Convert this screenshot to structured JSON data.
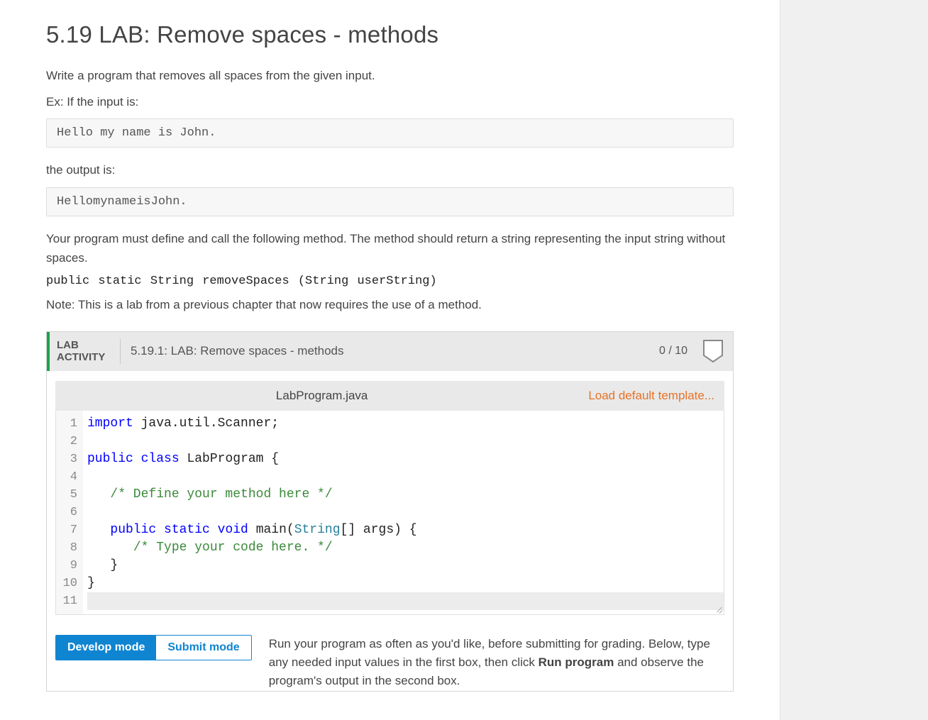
{
  "title": "5.19 LAB: Remove spaces - methods",
  "instructions": {
    "intro": "Write a program that removes all spaces from the given input.",
    "ex_label": "Ex: If the input is:",
    "example_input": "Hello my name is John.",
    "out_label": "the output is:",
    "example_output": "HellomynameisJohn.",
    "define_call": "Your program must define and call the following method. The method should return a string representing the input string without spaces.",
    "method_signature": "public static String removeSpaces (String userString)",
    "note": "Note: This is a lab from a previous chapter that now requires the use of a method."
  },
  "activity": {
    "badge_line1": "LAB",
    "badge_line2": "ACTIVITY",
    "title": "5.19.1: LAB: Remove spaces - methods",
    "score": "0 / 10",
    "file_name": "LabProgram.java",
    "load_template_label": "Load default template...",
    "code_lines": [
      {
        "n": "1",
        "tokens": [
          {
            "t": "import",
            "c": "kwd"
          },
          {
            "t": " java.util.Scanner;",
            "c": "pln"
          }
        ]
      },
      {
        "n": "2",
        "tokens": []
      },
      {
        "n": "3",
        "tokens": [
          {
            "t": "public",
            "c": "kwd"
          },
          {
            "t": " ",
            "c": "pln"
          },
          {
            "t": "class",
            "c": "kwd"
          },
          {
            "t": " ",
            "c": "pln"
          },
          {
            "t": "LabProgram",
            "c": "pln"
          },
          {
            "t": " {",
            "c": "pln"
          }
        ]
      },
      {
        "n": "4",
        "tokens": []
      },
      {
        "n": "5",
        "tokens": [
          {
            "t": "   ",
            "c": "pln"
          },
          {
            "t": "/* Define your method here */",
            "c": "cmt"
          }
        ]
      },
      {
        "n": "6",
        "tokens": []
      },
      {
        "n": "7",
        "tokens": [
          {
            "t": "   ",
            "c": "pln"
          },
          {
            "t": "public",
            "c": "kwd"
          },
          {
            "t": " ",
            "c": "pln"
          },
          {
            "t": "static",
            "c": "kwd"
          },
          {
            "t": " ",
            "c": "pln"
          },
          {
            "t": "void",
            "c": "kwd"
          },
          {
            "t": " ",
            "c": "pln"
          },
          {
            "t": "main(",
            "c": "pln"
          },
          {
            "t": "String",
            "c": "typ"
          },
          {
            "t": "[] args) {",
            "c": "pln"
          }
        ]
      },
      {
        "n": "8",
        "tokens": [
          {
            "t": "      ",
            "c": "pln"
          },
          {
            "t": "/* Type your code here. */",
            "c": "cmt"
          }
        ]
      },
      {
        "n": "9",
        "tokens": [
          {
            "t": "   }",
            "c": "pln"
          }
        ]
      },
      {
        "n": "10",
        "tokens": [
          {
            "t": "}",
            "c": "pln"
          }
        ]
      },
      {
        "n": "11",
        "tokens": [],
        "last": true
      }
    ]
  },
  "modes": {
    "develop": "Develop mode",
    "submit": "Submit mode",
    "help_pre": "Run your program as often as you'd like, before submitting for grading. Below, type any needed input values in the first box, then click ",
    "help_bold": "Run program",
    "help_post": " and observe the program's output in the second box."
  }
}
